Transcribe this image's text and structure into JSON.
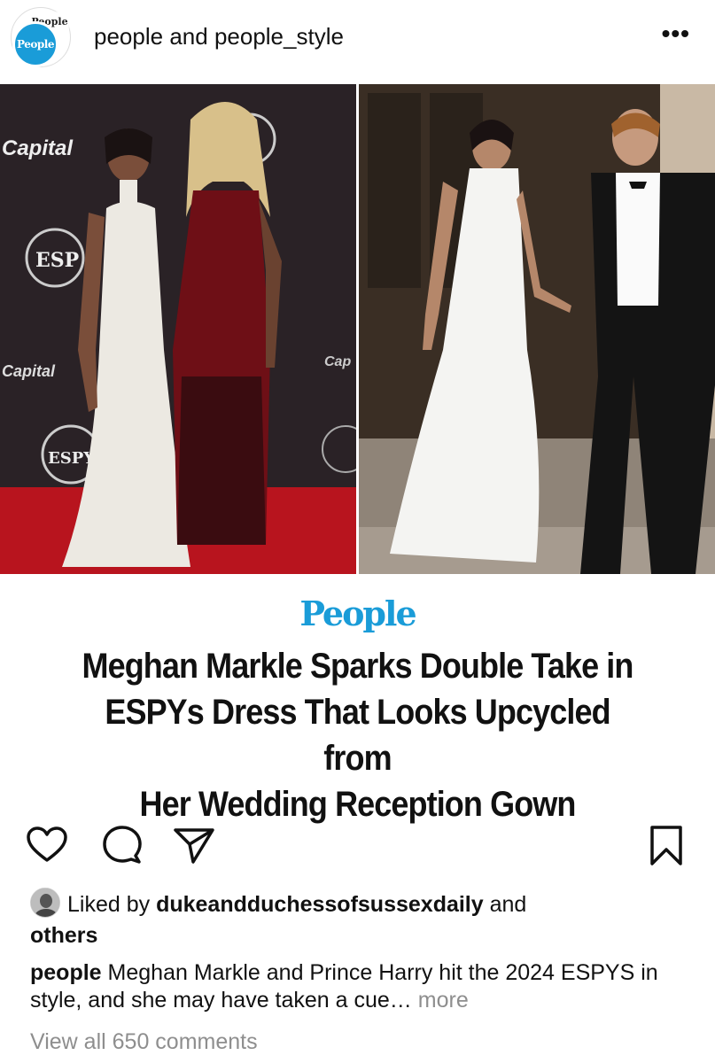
{
  "header": {
    "avatar_front_text": "People",
    "avatar_back_text": "People",
    "account_primary": "people",
    "joiner": "and",
    "account_secondary": "people_style",
    "more_menu": "•••"
  },
  "images": {
    "left": {
      "backdrop_text_1": "Capital One",
      "backdrop_text_2": "ESPYS",
      "colors": {
        "backdrop": "#2a2226",
        "carpet": "#b8141e",
        "white_dress": "#ece9e2",
        "red_dress": "#6e0f16"
      }
    },
    "right": {
      "colors": {
        "doorway": "#5a4a3a",
        "white_dress": "#f4f4f2",
        "tuxedo": "#141414"
      }
    }
  },
  "article": {
    "brand": "People",
    "brand_color": "#1a9cd8",
    "headline_lines": [
      "Meghan Markle Sparks Double Take in",
      "ESPYs Dress That Looks Upcycled from",
      "Her Wedding Reception Gown"
    ]
  },
  "actions": {
    "like": "heart-icon",
    "comment": "comment-icon",
    "share": "paper-plane-icon",
    "save": "bookmark-icon"
  },
  "likes": {
    "prefix": "Liked by",
    "user": "dukeandduchessofsussexdaily",
    "suffix": "and",
    "others": "others"
  },
  "caption": {
    "user": "people",
    "text": "Meghan Markle and Prince Harry hit the 2024 ESPYS in style, and she may have taken a cue…",
    "more": "more"
  },
  "comments": {
    "view_all": "View all 650 comments"
  }
}
